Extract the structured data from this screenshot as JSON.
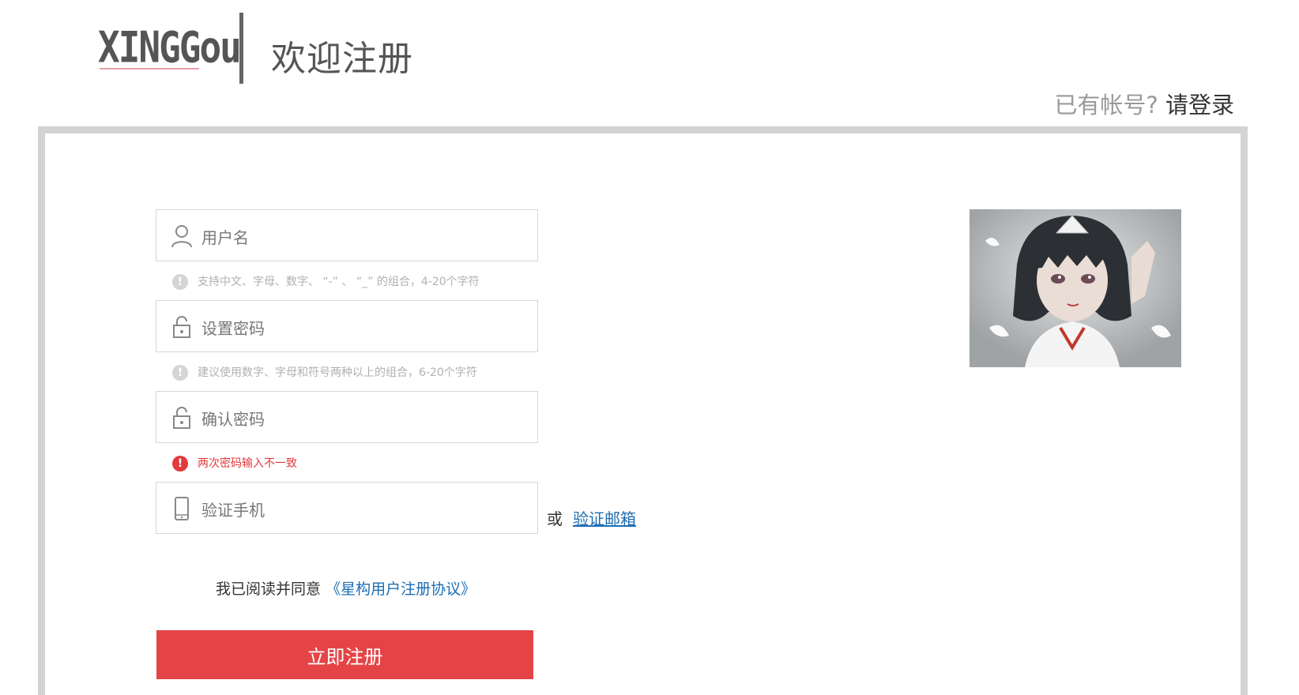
{
  "header": {
    "logo_text": "XINGGou",
    "title": "欢迎注册",
    "login_prompt": "已有帐号?",
    "login_link": "请登录"
  },
  "form": {
    "username_placeholder": "用户名",
    "username_tip": "支持中文、字母、数字、 “-” 、 “_” 的组合，4-20个字符",
    "password_placeholder": "设置密码",
    "password_tip": "建议使用数字、字母和符号两种以上的组合，6-20个字符",
    "confirm_placeholder": "确认密码",
    "confirm_error": "两次密码输入不一致",
    "phone_placeholder": "验证手机",
    "or_text": "或",
    "email_link": "验证邮箱",
    "agree_text": "我已阅读并同意",
    "agreement_link": "《星构用户注册协议》",
    "submit_label": "立即注册"
  },
  "colors": {
    "accent": "#e54446",
    "link": "#1c6db3",
    "error": "#e4393c",
    "panel_border": "#d3d3d3"
  },
  "icons": {
    "username": "user-icon",
    "password": "unlock-icon",
    "confirm": "unlock-icon",
    "phone": "mobile-phone-icon",
    "tip": "info-circle-icon",
    "error": "error-circle-icon"
  }
}
